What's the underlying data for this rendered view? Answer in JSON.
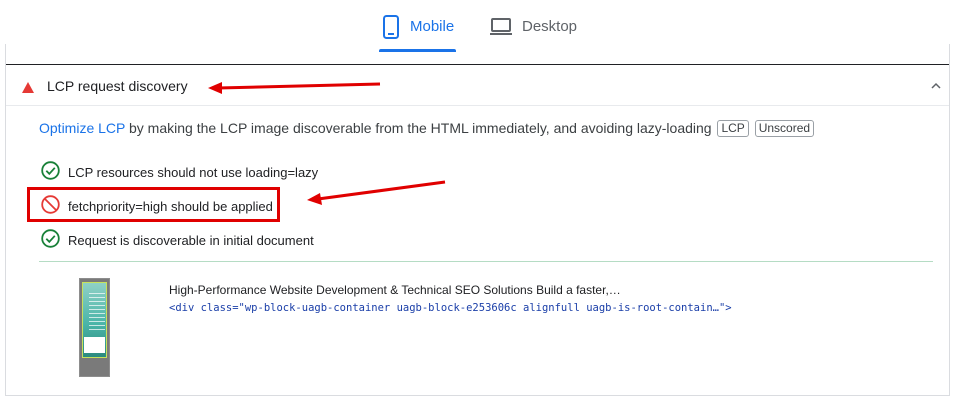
{
  "tabs": [
    {
      "label": "Mobile",
      "icon": "smartphone-icon",
      "active": true
    },
    {
      "label": "Desktop",
      "icon": "laptop-icon",
      "active": false
    }
  ],
  "audit": {
    "title": "LCP request discovery",
    "status_icon": "fail-triangle-icon",
    "description": {
      "link_text": "Optimize LCP",
      "text": " by making the LCP image discoverable from the HTML immediately, and avoiding lazy-loading",
      "badges": [
        "LCP",
        "Unscored"
      ]
    },
    "checks": [
      {
        "label": "LCP resources should not use loading=lazy",
        "status": "pass"
      },
      {
        "label": "fetchpriority=high should be applied",
        "status": "fail"
      },
      {
        "label": "Request is discoverable in initial document",
        "status": "pass"
      }
    ],
    "node": {
      "text": "High-Performance Website Development & Technical SEO Solutions Build a faster,…",
      "snippet": "<div class=\"wp-block-uagb-container uagb-block-e253606c alignfull uagb-is-root-contain…\">"
    }
  },
  "colors": {
    "accent": "#1a73e8",
    "fail": "#e53935",
    "pass": "#188038",
    "annotation": "#e00000"
  }
}
